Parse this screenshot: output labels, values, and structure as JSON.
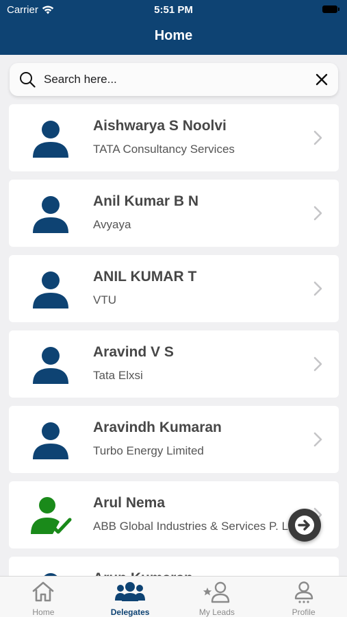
{
  "status_bar": {
    "carrier": "Carrier",
    "time": "5:51 PM"
  },
  "header": {
    "title": "Home"
  },
  "search": {
    "placeholder": "Search here..."
  },
  "delegates": [
    {
      "name": "Aishwarya S Noolvi",
      "company": "TATA Consultancy Services",
      "icon": "person-icon",
      "status": "default"
    },
    {
      "name": "Anil Kumar B N",
      "company": "Avyaya",
      "icon": "person-icon",
      "status": "default"
    },
    {
      "name": "ANIL KUMAR T",
      "company": "VTU",
      "icon": "person-icon",
      "status": "default"
    },
    {
      "name": "Aravind V S",
      "company": "Tata Elxsi",
      "icon": "person-icon",
      "status": "default"
    },
    {
      "name": "Aravindh Kumaran",
      "company": "Turbo Energy Limited",
      "icon": "person-icon",
      "status": "default"
    },
    {
      "name": "Arul Nema",
      "company": "ABB Global Industries & Services P. Ltd",
      "icon": "person-check-icon",
      "status": "checked-in"
    },
    {
      "name": "Arun Kumaran",
      "company": "",
      "icon": "person-icon",
      "status": "default"
    }
  ],
  "tabs": [
    {
      "label": "Home",
      "icon": "home-icon",
      "active": false
    },
    {
      "label": "Delegates",
      "icon": "people-icon",
      "active": true
    },
    {
      "label": "My Leads",
      "icon": "star-person-icon",
      "active": false
    },
    {
      "label": "Profile",
      "icon": "profile-icon",
      "active": false
    }
  ],
  "colors": {
    "brand": "#0e4373",
    "checked_in": "#1a8a1a",
    "inactive_tab": "#8a8a8a"
  }
}
